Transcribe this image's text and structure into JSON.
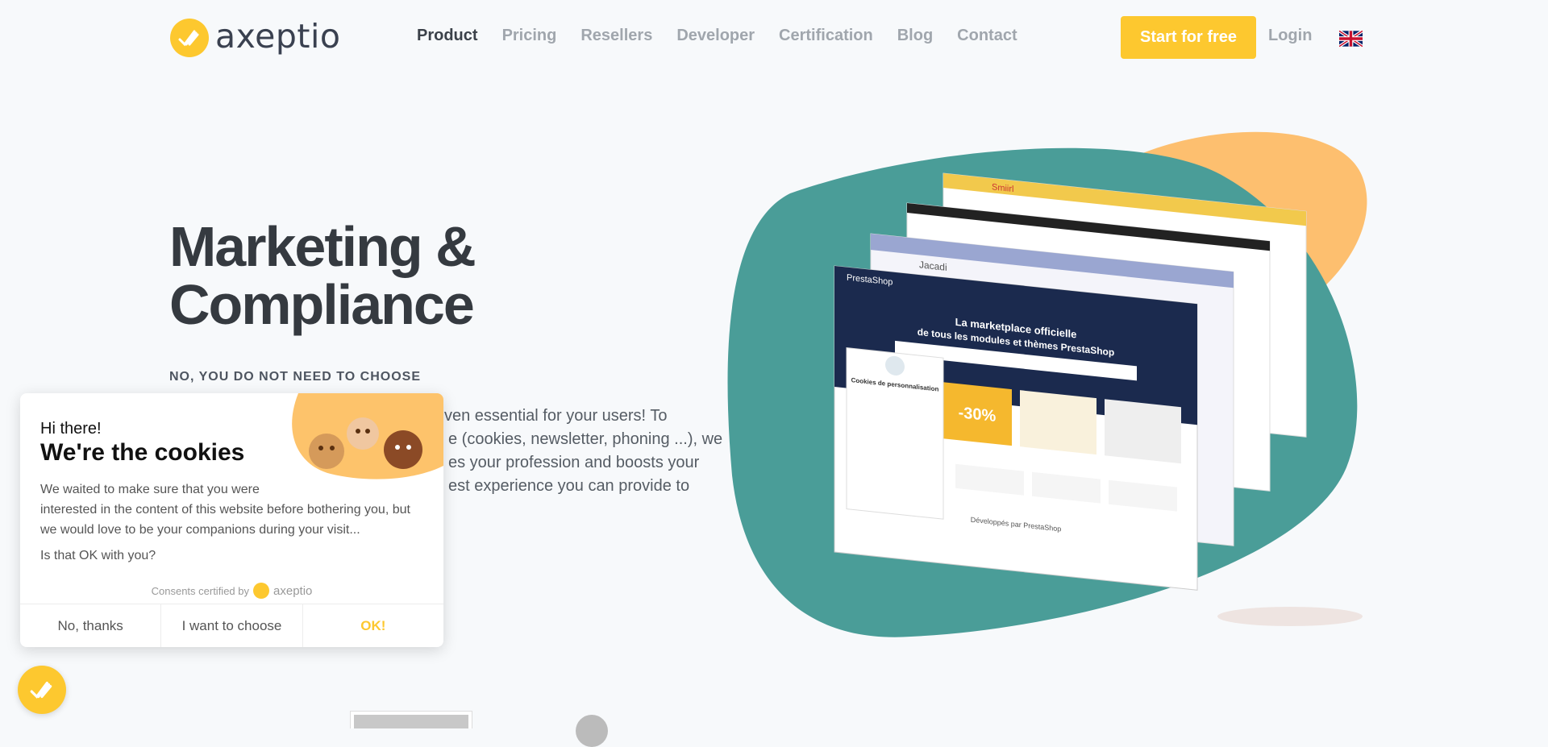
{
  "brand": {
    "name": "axeptio",
    "color": "#fdc82f"
  },
  "nav": {
    "items": [
      {
        "label": "Product",
        "active": true
      },
      {
        "label": "Pricing"
      },
      {
        "label": "Resellers"
      },
      {
        "label": "Developer"
      },
      {
        "label": "Certification"
      },
      {
        "label": "Blog"
      },
      {
        "label": "Contact"
      }
    ],
    "cta_label": "Start for free",
    "login_label": "Login",
    "language_icon": "uk-flag-icon"
  },
  "hero": {
    "title_line1": "Marketing &",
    "title_line2": "Compliance",
    "subtitle": "NO, YOU DO NOT NEED TO CHOOSE",
    "body_visible": [
      "ven essential for your users!  To",
      "e (cookies, newsletter, phoning ...), we",
      "es your profession and boosts your",
      "est experience you can provide to"
    ]
  },
  "illustration": {
    "panel_title_1": "La marketplace officielle",
    "panel_title_2": "de tous les modules et thèmes PrestaShop",
    "promo": "-30%",
    "footer": "Développés par PrestaShop",
    "brand1": "PrestaShop",
    "brand2": "Smiirl",
    "brand3": "Jacadi",
    "consent_title": "Cookies de personnalisation"
  },
  "cookie": {
    "greeting": "Hi there!",
    "title": "We're the cookies",
    "text_line1": "We waited to make sure that you were",
    "text_rest": "interested in the content of this website before bothering you, but we would love to be your companions during your visit...",
    "question": "Is that OK with you?",
    "certified": "Consents certified by",
    "certified_brand": "axeptio",
    "buttons": {
      "reject": "No, thanks",
      "choose": "I want to choose",
      "accept": "OK!"
    }
  }
}
